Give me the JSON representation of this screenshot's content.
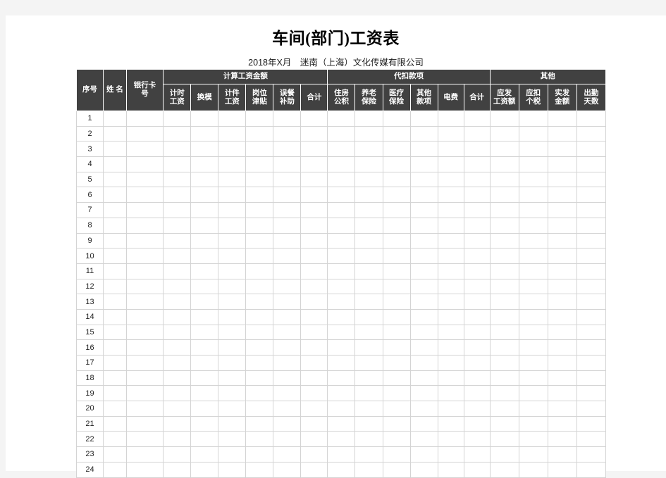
{
  "document": {
    "title": "车间(部门)工资表",
    "subtitle": "2018年X月　迷南（上海）文化传媒有限公司"
  },
  "theme": {
    "header_bg": "#414141",
    "header_text": "#ffffff",
    "grid_color": "#d4d4d4",
    "page_bg": "#f4f4f4",
    "sheet_bg": "#ffffff"
  },
  "table": {
    "groups": [
      {
        "label": "",
        "span": 3
      },
      {
        "label": "计算工资金额",
        "span": 6
      },
      {
        "label": "代扣款项",
        "span": 6
      },
      {
        "label": "其他",
        "span": 4
      }
    ],
    "leading_columns": [
      {
        "label": "序号"
      },
      {
        "label": "姓 名"
      },
      {
        "label": "银行卡号",
        "line1": "银行卡",
        "line2": "号"
      }
    ],
    "columns": [
      {
        "label": "计时工资",
        "line1": "计时",
        "line2": "工资"
      },
      {
        "label": "换模",
        "line1": "换模",
        "line2": ""
      },
      {
        "label": "计件工资",
        "line1": "计件",
        "line2": "工资"
      },
      {
        "label": "岗位津贴",
        "line1": "岗位",
        "line2": "津贴"
      },
      {
        "label": "误餐补助",
        "line1": "误餐",
        "line2": "补助"
      },
      {
        "label": "合计",
        "line1": "合计",
        "line2": ""
      },
      {
        "label": "住房公积",
        "line1": "住房",
        "line2": "公积"
      },
      {
        "label": "养老保险",
        "line1": "养老",
        "line2": "保险"
      },
      {
        "label": "医疗保险",
        "line1": "医疗",
        "line2": "保险"
      },
      {
        "label": "其他款项",
        "line1": "其他",
        "line2": "款项"
      },
      {
        "label": "电费",
        "line1": "电费",
        "line2": ""
      },
      {
        "label": "合计",
        "line1": "合计",
        "line2": ""
      },
      {
        "label": "应发工资额",
        "line1": "应发",
        "line2": "工资额"
      },
      {
        "label": "应扣个税",
        "line1": "应扣",
        "line2": "个税"
      },
      {
        "label": "实发金额",
        "line1": "实发",
        "line2": "金额"
      },
      {
        "label": "出勤天数",
        "line1": "出勤",
        "line2": "天数"
      }
    ],
    "rows": [
      {
        "index": "1"
      },
      {
        "index": "2"
      },
      {
        "index": "3"
      },
      {
        "index": "4"
      },
      {
        "index": "5"
      },
      {
        "index": "6"
      },
      {
        "index": "7"
      },
      {
        "index": "8"
      },
      {
        "index": "9"
      },
      {
        "index": "10"
      },
      {
        "index": "11"
      },
      {
        "index": "12"
      },
      {
        "index": "13"
      },
      {
        "index": "14"
      },
      {
        "index": "15"
      },
      {
        "index": "16"
      },
      {
        "index": "17"
      },
      {
        "index": "18"
      },
      {
        "index": "19"
      },
      {
        "index": "20"
      },
      {
        "index": "21"
      },
      {
        "index": "22"
      },
      {
        "index": "23"
      },
      {
        "index": "24"
      }
    ]
  }
}
